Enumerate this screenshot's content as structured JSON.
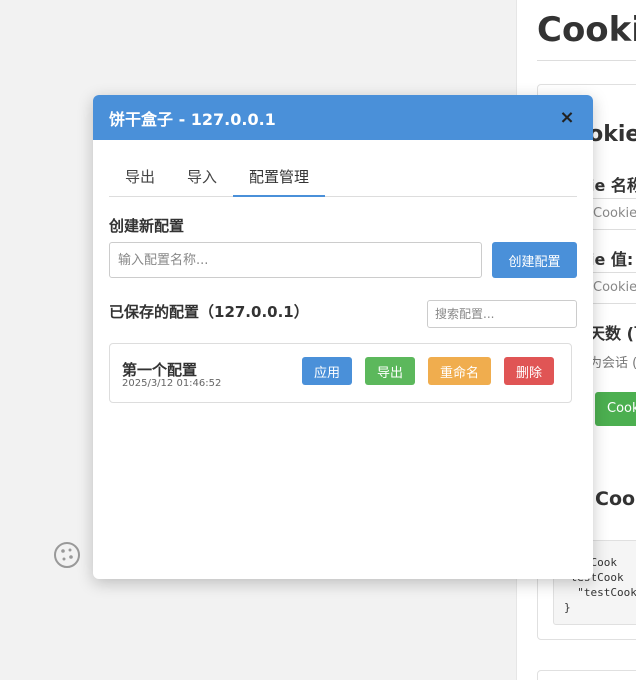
{
  "background_page": {
    "title": "Cookie",
    "section_heading": "ookie",
    "name_label": "ie 名称",
    "name_placeholder": "Cookie",
    "value_label": "ie 值:",
    "value_placeholder": "Cookie",
    "days_label": "天数 (可",
    "days_hint": "为会话 (",
    "set_button": "Cookie",
    "list_heading": "Cooki",
    "code_lines": "testCook\n testCook\n  \"testCook\n}"
  },
  "modal": {
    "title": "饼干盒子 - 127.0.0.1",
    "close_symbol": "×",
    "tabs": [
      {
        "label": "导出",
        "active": false
      },
      {
        "label": "导入",
        "active": false
      },
      {
        "label": "配置管理",
        "active": true
      }
    ],
    "create_section_title": "创建新配置",
    "name_input_placeholder": "输入配置名称...",
    "create_button": "创建配置",
    "saved_section_title": "已保存的配置（127.0.0.1）",
    "search_placeholder": "搜索配置...",
    "configs": [
      {
        "name": "第一个配置",
        "date": "2025/3/12 01:46:52",
        "actions": {
          "apply": "应用",
          "export": "导出",
          "rename": "重命名",
          "delete": "删除"
        }
      }
    ]
  },
  "colors": {
    "primary": "#4a90d9",
    "success": "#5cb85c",
    "warning": "#f0ad4e",
    "danger": "#e05555"
  },
  "icons": {
    "floating": "cookie-icon"
  }
}
